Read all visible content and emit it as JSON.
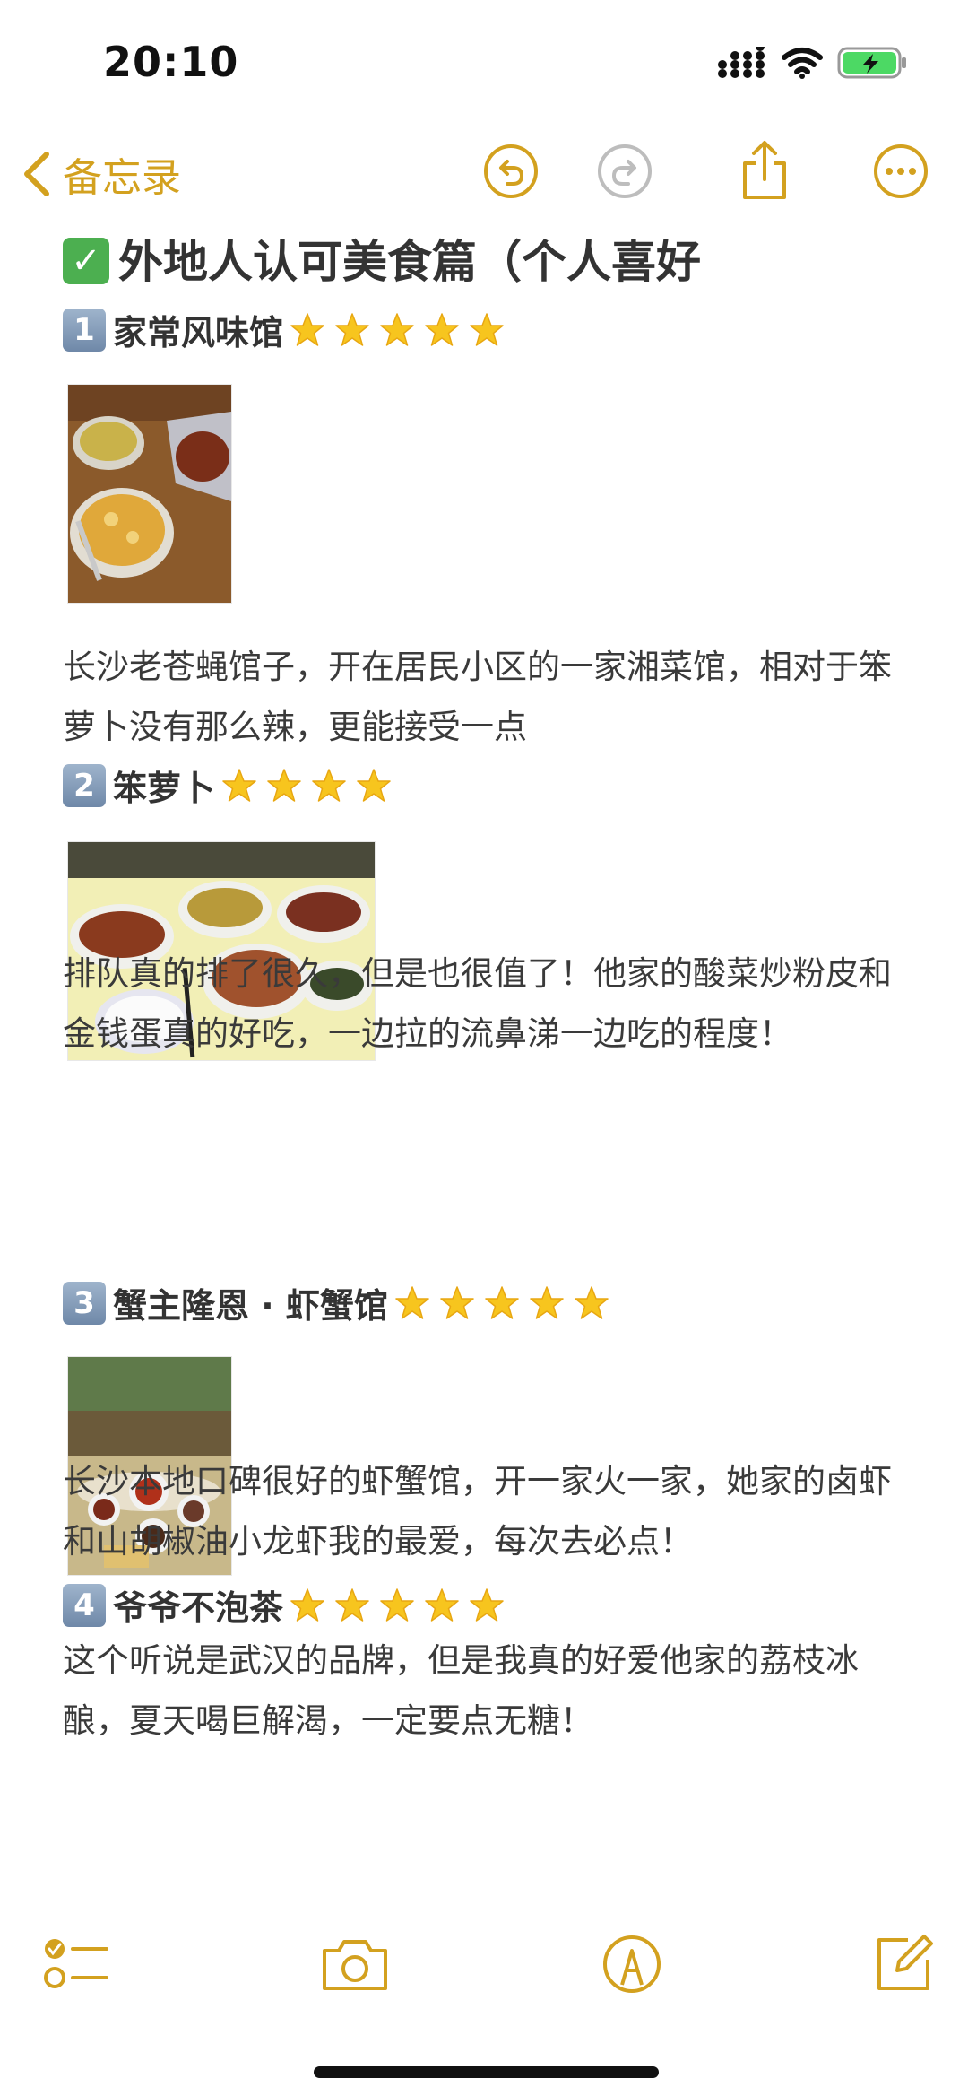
{
  "status": {
    "time": "20:10"
  },
  "nav": {
    "back_label": "备忘录"
  },
  "note": {
    "title": "外地人认可美食篇（个人喜好",
    "items": [
      {
        "number": "1",
        "name": "家常风味馆",
        "stars": 5,
        "desc": "长沙老苍蝇馆子，开在居民小区的一家湘菜馆，相对于笨萝卜没有那么辣，更能接受一点"
      },
      {
        "number": "2",
        "name": "笨萝卜",
        "stars": 4,
        "desc": "排队真的排了很久，但是也很值了！他家的酸菜炒粉皮和金钱蛋真的好吃，一边拉的流鼻涕一边吃的程度！"
      },
      {
        "number": "3",
        "name": " 蟹主隆恩 · 虾蟹馆",
        "stars": 5,
        "desc": "长沙本地口碑很好的虾蟹馆，开一家火一家，她家的卤虾和山胡椒油小龙虾我的最爱，每次去必点！"
      },
      {
        "number": "4",
        "name": "爷爷不泡茶",
        "stars": 5,
        "desc": "这个听说是武汉的品牌，但是我真的好爱他家的荔枝冰酿，夏天喝巨解渴，一定要点无糖！"
      }
    ]
  },
  "colors": {
    "accent": "#d3a11f",
    "text": "#3a3a3a",
    "check_green": "#4caf50"
  },
  "icons": {
    "status": [
      "cellular-signal-icon",
      "wifi-icon",
      "battery-charging-icon"
    ],
    "nav": [
      "chevron-left-icon",
      "undo-icon",
      "redo-icon",
      "share-icon",
      "more-icon"
    ],
    "toolbar": [
      "checklist-icon",
      "camera-icon",
      "markup-icon",
      "compose-icon"
    ]
  }
}
